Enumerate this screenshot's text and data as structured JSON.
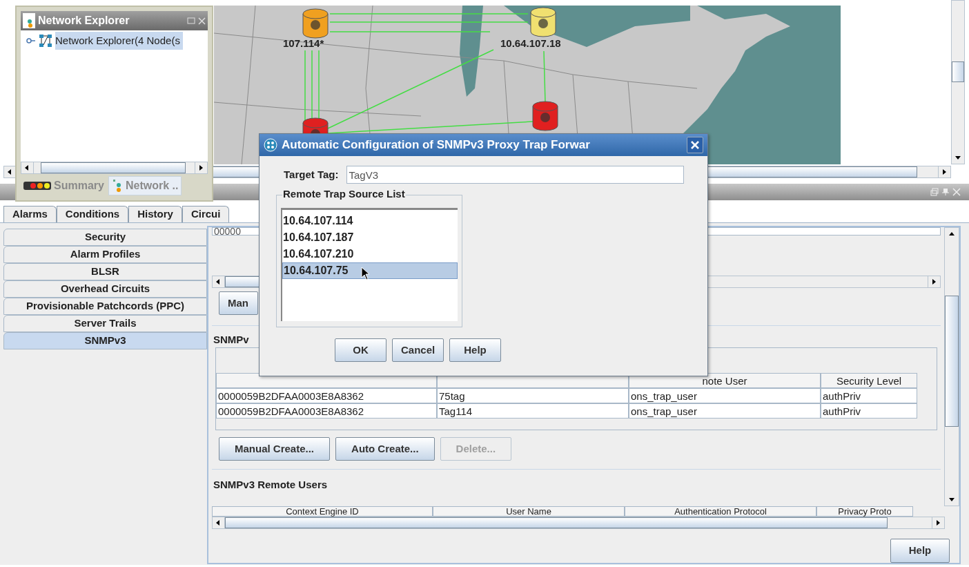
{
  "map": {
    "nodes": [
      {
        "label": "107.114*",
        "color": "#f0a020"
      },
      {
        "label": "10.64.107.18",
        "color": "#f0e070"
      },
      {
        "color": "#e02020"
      },
      {
        "color": "#e02020"
      }
    ]
  },
  "network_explorer": {
    "title": "Network Explorer",
    "tree": [
      {
        "label": "Network Explorer(4 Node(s",
        "selected": true
      }
    ],
    "tabs": [
      {
        "label": "Summary",
        "selected": false
      },
      {
        "label": "Network ..",
        "selected": true
      }
    ]
  },
  "main_tabs": [
    {
      "label": "Alarms",
      "selected": false
    },
    {
      "label": "Conditions",
      "selected": false
    },
    {
      "label": "History",
      "selected": false
    },
    {
      "label": "Circui",
      "selected": false
    }
  ],
  "side_tabs": [
    {
      "label": "Security",
      "selected": false
    },
    {
      "label": "Alarm Profiles",
      "selected": false
    },
    {
      "label": "BLSR",
      "selected": false
    },
    {
      "label": "Overhead Circuits",
      "selected": false
    },
    {
      "label": "Provisionable Patchcords (PPC)",
      "selected": false
    },
    {
      "label": "Server Trails",
      "selected": false
    },
    {
      "label": "SNMPv3",
      "selected": true
    }
  ],
  "content": {
    "top_table_row": "00000",
    "top_button": "Man",
    "trap_section": {
      "title": "SNMPv",
      "columns": [
        "",
        "",
        "note User",
        "Security Level"
      ],
      "rows": [
        [
          "0000059B2DFAA0003E8A8362",
          "75tag",
          "ons_trap_user",
          "authPriv"
        ],
        [
          "0000059B2DFAA0003E8A8362",
          "Tag114",
          "ons_trap_user",
          "authPriv"
        ]
      ],
      "buttons": [
        {
          "label": "Manual Create...",
          "disabled": false
        },
        {
          "label": "Auto Create...",
          "disabled": false
        },
        {
          "label": "Delete...",
          "disabled": true
        }
      ]
    },
    "remote_users": {
      "title": "SNMPv3 Remote Users",
      "columns": [
        "Context Engine ID",
        "User Name",
        "Authentication Protocol",
        "Privacy Proto"
      ]
    },
    "help_button": "Help"
  },
  "dialog": {
    "title": "Automatic Configuration of SNMPv3 Proxy Trap Forwar",
    "target_tag_label": "Target Tag:",
    "target_tag": "TagV3",
    "list_title": "Remote Trap Source List",
    "sources": [
      {
        "label": "10.64.107.114",
        "selected": false
      },
      {
        "label": "10.64.107.187",
        "selected": false
      },
      {
        "label": "10.64.107.210",
        "selected": false
      },
      {
        "label": "10.64.107.75",
        "selected": true
      }
    ],
    "buttons": [
      "OK",
      "Cancel",
      "Help"
    ]
  }
}
